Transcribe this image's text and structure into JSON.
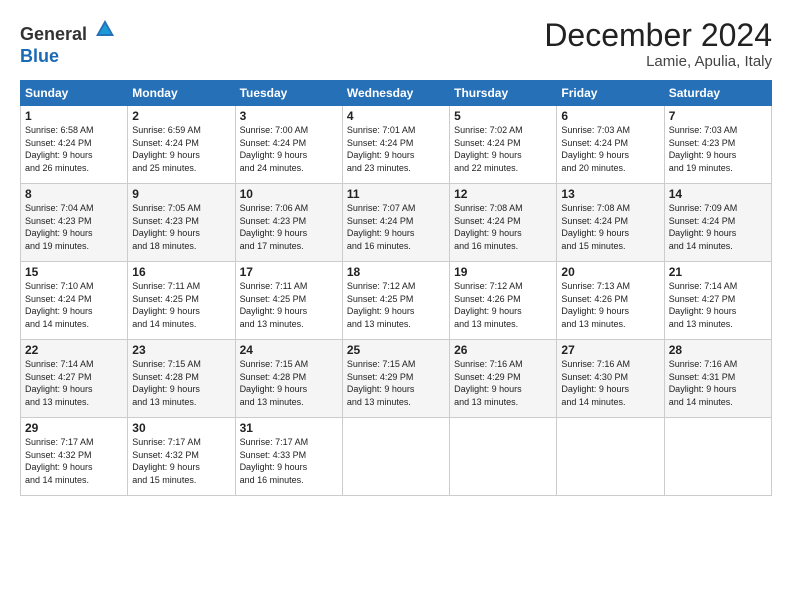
{
  "header": {
    "logo_general": "General",
    "logo_blue": "Blue",
    "month": "December 2024",
    "location": "Lamie, Apulia, Italy"
  },
  "days_of_week": [
    "Sunday",
    "Monday",
    "Tuesday",
    "Wednesday",
    "Thursday",
    "Friday",
    "Saturday"
  ],
  "weeks": [
    [
      {
        "day": "1",
        "info": "Sunrise: 6:58 AM\nSunset: 4:24 PM\nDaylight: 9 hours\nand 26 minutes."
      },
      {
        "day": "2",
        "info": "Sunrise: 6:59 AM\nSunset: 4:24 PM\nDaylight: 9 hours\nand 25 minutes."
      },
      {
        "day": "3",
        "info": "Sunrise: 7:00 AM\nSunset: 4:24 PM\nDaylight: 9 hours\nand 24 minutes."
      },
      {
        "day": "4",
        "info": "Sunrise: 7:01 AM\nSunset: 4:24 PM\nDaylight: 9 hours\nand 23 minutes."
      },
      {
        "day": "5",
        "info": "Sunrise: 7:02 AM\nSunset: 4:24 PM\nDaylight: 9 hours\nand 22 minutes."
      },
      {
        "day": "6",
        "info": "Sunrise: 7:03 AM\nSunset: 4:24 PM\nDaylight: 9 hours\nand 20 minutes."
      },
      {
        "day": "7",
        "info": "Sunrise: 7:03 AM\nSunset: 4:23 PM\nDaylight: 9 hours\nand 19 minutes."
      }
    ],
    [
      {
        "day": "8",
        "info": "Sunrise: 7:04 AM\nSunset: 4:23 PM\nDaylight: 9 hours\nand 19 minutes."
      },
      {
        "day": "9",
        "info": "Sunrise: 7:05 AM\nSunset: 4:23 PM\nDaylight: 9 hours\nand 18 minutes."
      },
      {
        "day": "10",
        "info": "Sunrise: 7:06 AM\nSunset: 4:23 PM\nDaylight: 9 hours\nand 17 minutes."
      },
      {
        "day": "11",
        "info": "Sunrise: 7:07 AM\nSunset: 4:24 PM\nDaylight: 9 hours\nand 16 minutes."
      },
      {
        "day": "12",
        "info": "Sunrise: 7:08 AM\nSunset: 4:24 PM\nDaylight: 9 hours\nand 16 minutes."
      },
      {
        "day": "13",
        "info": "Sunrise: 7:08 AM\nSunset: 4:24 PM\nDaylight: 9 hours\nand 15 minutes."
      },
      {
        "day": "14",
        "info": "Sunrise: 7:09 AM\nSunset: 4:24 PM\nDaylight: 9 hours\nand 14 minutes."
      }
    ],
    [
      {
        "day": "15",
        "info": "Sunrise: 7:10 AM\nSunset: 4:24 PM\nDaylight: 9 hours\nand 14 minutes."
      },
      {
        "day": "16",
        "info": "Sunrise: 7:11 AM\nSunset: 4:25 PM\nDaylight: 9 hours\nand 14 minutes."
      },
      {
        "day": "17",
        "info": "Sunrise: 7:11 AM\nSunset: 4:25 PM\nDaylight: 9 hours\nand 13 minutes."
      },
      {
        "day": "18",
        "info": "Sunrise: 7:12 AM\nSunset: 4:25 PM\nDaylight: 9 hours\nand 13 minutes."
      },
      {
        "day": "19",
        "info": "Sunrise: 7:12 AM\nSunset: 4:26 PM\nDaylight: 9 hours\nand 13 minutes."
      },
      {
        "day": "20",
        "info": "Sunrise: 7:13 AM\nSunset: 4:26 PM\nDaylight: 9 hours\nand 13 minutes."
      },
      {
        "day": "21",
        "info": "Sunrise: 7:14 AM\nSunset: 4:27 PM\nDaylight: 9 hours\nand 13 minutes."
      }
    ],
    [
      {
        "day": "22",
        "info": "Sunrise: 7:14 AM\nSunset: 4:27 PM\nDaylight: 9 hours\nand 13 minutes."
      },
      {
        "day": "23",
        "info": "Sunrise: 7:15 AM\nSunset: 4:28 PM\nDaylight: 9 hours\nand 13 minutes."
      },
      {
        "day": "24",
        "info": "Sunrise: 7:15 AM\nSunset: 4:28 PM\nDaylight: 9 hours\nand 13 minutes."
      },
      {
        "day": "25",
        "info": "Sunrise: 7:15 AM\nSunset: 4:29 PM\nDaylight: 9 hours\nand 13 minutes."
      },
      {
        "day": "26",
        "info": "Sunrise: 7:16 AM\nSunset: 4:29 PM\nDaylight: 9 hours\nand 13 minutes."
      },
      {
        "day": "27",
        "info": "Sunrise: 7:16 AM\nSunset: 4:30 PM\nDaylight: 9 hours\nand 14 minutes."
      },
      {
        "day": "28",
        "info": "Sunrise: 7:16 AM\nSunset: 4:31 PM\nDaylight: 9 hours\nand 14 minutes."
      }
    ],
    [
      {
        "day": "29",
        "info": "Sunrise: 7:17 AM\nSunset: 4:32 PM\nDaylight: 9 hours\nand 14 minutes."
      },
      {
        "day": "30",
        "info": "Sunrise: 7:17 AM\nSunset: 4:32 PM\nDaylight: 9 hours\nand 15 minutes."
      },
      {
        "day": "31",
        "info": "Sunrise: 7:17 AM\nSunset: 4:33 PM\nDaylight: 9 hours\nand 16 minutes."
      },
      null,
      null,
      null,
      null
    ]
  ]
}
